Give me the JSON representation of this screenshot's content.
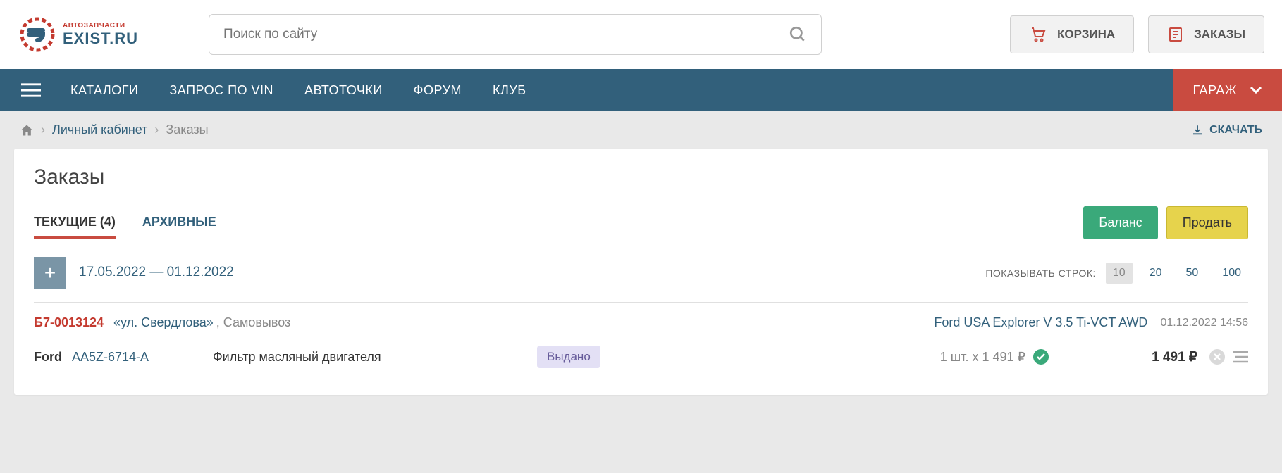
{
  "logo": {
    "sub": "АВТОЗАПЧАСТИ",
    "main": "EXIST.RU"
  },
  "search": {
    "placeholder": "Поиск по сайту"
  },
  "header_buttons": {
    "cart": "КОРЗИНА",
    "orders": "ЗАКАЗЫ"
  },
  "nav": {
    "items": [
      "КАТАЛОГИ",
      "ЗАПРОС ПО VIN",
      "АВТОТОЧКИ",
      "ФОРУМ",
      "КЛУБ"
    ],
    "garage": "ГАРАЖ"
  },
  "breadcrumb": {
    "personal": "Личный кабинет",
    "current": "Заказы",
    "download": "СКАЧАТЬ"
  },
  "page": {
    "title": "Заказы",
    "tabs": {
      "current": "ТЕКУЩИЕ (4)",
      "archive": "АРХИВНЫЕ"
    },
    "actions": {
      "balance": "Баланс",
      "sell": "Продать"
    }
  },
  "filter": {
    "date_range": "17.05.2022 — 01.12.2022",
    "rows_label": "ПОКАЗЫВАТЬ СТРОК:",
    "rows": [
      "10",
      "20",
      "50",
      "100"
    ]
  },
  "order": {
    "number": "Б7-0013124",
    "address": "«ул. Свердлова»",
    "pickup": ", Самовывоз",
    "vehicle": "Ford USA Explorer V 3.5 Ti-VCT AWD",
    "datetime": "01.12.2022 14:56",
    "line": {
      "brand": "Ford",
      "code": "AA5Z-6714-A",
      "desc": "Фильтр масляный двигателя",
      "status": "Выдано",
      "qty_price": "1 шт. x 1 491 ₽",
      "total": "1 491 ₽"
    }
  }
}
